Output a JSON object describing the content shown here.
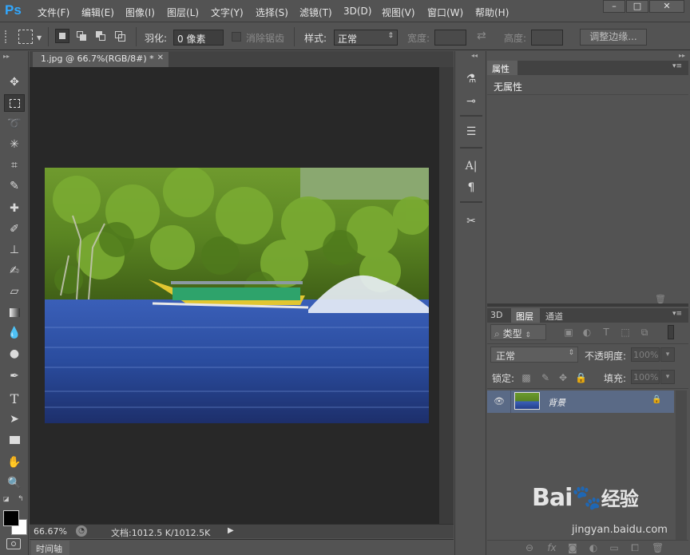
{
  "app": {
    "logo": "Ps"
  },
  "menu": [
    "文件(F)",
    "编辑(E)",
    "图像(I)",
    "图层(L)",
    "文字(Y)",
    "选择(S)",
    "滤镜(T)",
    "3D(D)",
    "视图(V)",
    "窗口(W)",
    "帮助(H)"
  ],
  "window_controls": {
    "minimize": "–",
    "maximize": "□",
    "close": "✕"
  },
  "options": {
    "feather_label": "羽化:",
    "feather_value": "0 像素",
    "antialias_label": "消除锯齿",
    "style_label": "样式:",
    "style_value": "正常",
    "width_label": "宽度:",
    "height_label": "高度:",
    "refine_edge": "调整边缘..."
  },
  "document": {
    "tab_title": "1.jpg @ 66.7%(RGB/8#) *",
    "zoom": "66.67%",
    "doc_info": "文档:1012.5 K/1012.5K"
  },
  "timeline_label": "时间轴",
  "properties": {
    "tab": "属性",
    "content": "无属性"
  },
  "layers": {
    "tabs": [
      "3D",
      "图层",
      "通道"
    ],
    "filter_kind": "类型",
    "blend_mode": "正常",
    "opacity_label": "不透明度:",
    "opacity_value": "100%",
    "lock_label": "锁定:",
    "fill_label": "填充:",
    "fill_value": "100%",
    "layer_name": "背景"
  },
  "watermark": {
    "site": "jingyan.baidu.com",
    "brand": "Bai",
    "brand_tail": "经验"
  },
  "colors": {
    "accent": "#31a8ff",
    "panel": "#535353",
    "canvas": "#282828",
    "layer_selected": "#5a6a86"
  }
}
